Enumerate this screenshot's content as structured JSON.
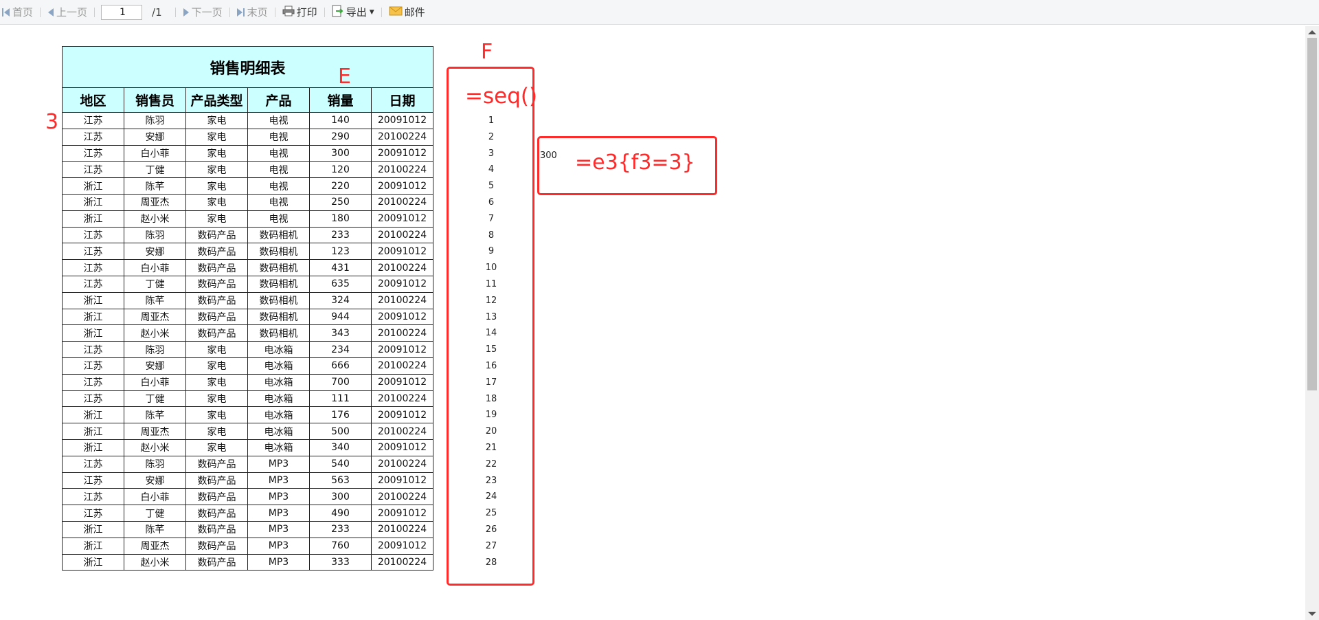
{
  "toolbar": {
    "first_label": "首页",
    "prev_label": "上一页",
    "page_value": "1",
    "page_total": "/1",
    "next_label": "下一页",
    "last_label": "末页",
    "print_label": "打印",
    "export_label": "导出",
    "mail_label": "邮件"
  },
  "report": {
    "title": "销售明细表",
    "headers": [
      "地区",
      "销售员",
      "产品类型",
      "产品",
      "销量",
      "日期"
    ],
    "rows": [
      [
        "江苏",
        "陈羽",
        "家电",
        "电视",
        "140",
        "20091012"
      ],
      [
        "江苏",
        "安娜",
        "家电",
        "电视",
        "290",
        "20100224"
      ],
      [
        "江苏",
        "白小菲",
        "家电",
        "电视",
        "300",
        "20091012"
      ],
      [
        "江苏",
        "丁健",
        "家电",
        "电视",
        "120",
        "20100224"
      ],
      [
        "浙江",
        "陈芊",
        "家电",
        "电视",
        "220",
        "20091012"
      ],
      [
        "浙江",
        "周亚杰",
        "家电",
        "电视",
        "250",
        "20100224"
      ],
      [
        "浙江",
        "赵小米",
        "家电",
        "电视",
        "180",
        "20091012"
      ],
      [
        "江苏",
        "陈羽",
        "数码产品",
        "数码相机",
        "233",
        "20100224"
      ],
      [
        "江苏",
        "安娜",
        "数码产品",
        "数码相机",
        "123",
        "20091012"
      ],
      [
        "江苏",
        "白小菲",
        "数码产品",
        "数码相机",
        "431",
        "20100224"
      ],
      [
        "江苏",
        "丁健",
        "数码产品",
        "数码相机",
        "635",
        "20091012"
      ],
      [
        "浙江",
        "陈芊",
        "数码产品",
        "数码相机",
        "324",
        "20100224"
      ],
      [
        "浙江",
        "周亚杰",
        "数码产品",
        "数码相机",
        "944",
        "20091012"
      ],
      [
        "浙江",
        "赵小米",
        "数码产品",
        "数码相机",
        "343",
        "20100224"
      ],
      [
        "江苏",
        "陈羽",
        "家电",
        "电冰箱",
        "234",
        "20091012"
      ],
      [
        "江苏",
        "安娜",
        "家电",
        "电冰箱",
        "666",
        "20100224"
      ],
      [
        "江苏",
        "白小菲",
        "家电",
        "电冰箱",
        "700",
        "20091012"
      ],
      [
        "江苏",
        "丁健",
        "家电",
        "电冰箱",
        "111",
        "20100224"
      ],
      [
        "浙江",
        "陈芊",
        "家电",
        "电冰箱",
        "176",
        "20091012"
      ],
      [
        "浙江",
        "周亚杰",
        "家电",
        "电冰箱",
        "500",
        "20100224"
      ],
      [
        "浙江",
        "赵小米",
        "家电",
        "电冰箱",
        "340",
        "20091012"
      ],
      [
        "江苏",
        "陈羽",
        "数码产品",
        "MP3",
        "540",
        "20100224"
      ],
      [
        "江苏",
        "安娜",
        "数码产品",
        "MP3",
        "563",
        "20091012"
      ],
      [
        "江苏",
        "白小菲",
        "数码产品",
        "MP3",
        "300",
        "20100224"
      ],
      [
        "江苏",
        "丁健",
        "数码产品",
        "MP3",
        "490",
        "20091012"
      ],
      [
        "浙江",
        "陈芊",
        "数码产品",
        "MP3",
        "233",
        "20100224"
      ],
      [
        "浙江",
        "周亚杰",
        "数码产品",
        "MP3",
        "760",
        "20091012"
      ],
      [
        "浙江",
        "赵小米",
        "数码产品",
        "MP3",
        "333",
        "20100224"
      ]
    ],
    "seq_numbers": [
      "1",
      "2",
      "3",
      "4",
      "5",
      "6",
      "7",
      "8",
      "9",
      "10",
      "11",
      "12",
      "13",
      "14",
      "15",
      "16",
      "17",
      "18",
      "19",
      "20",
      "21",
      "22",
      "23",
      "24",
      "25",
      "26",
      "27",
      "28"
    ],
    "result_value": "300"
  },
  "annotations": {
    "col_e": "E",
    "col_f": "F",
    "row_3": "3",
    "seq_formula": "=seq()",
    "filter_formula": "=e3{f3=3}",
    "color": "#ff2a2a"
  },
  "colors": {
    "header_bg": "#ccffff",
    "toolbar_bg": "#f5f6f7"
  }
}
